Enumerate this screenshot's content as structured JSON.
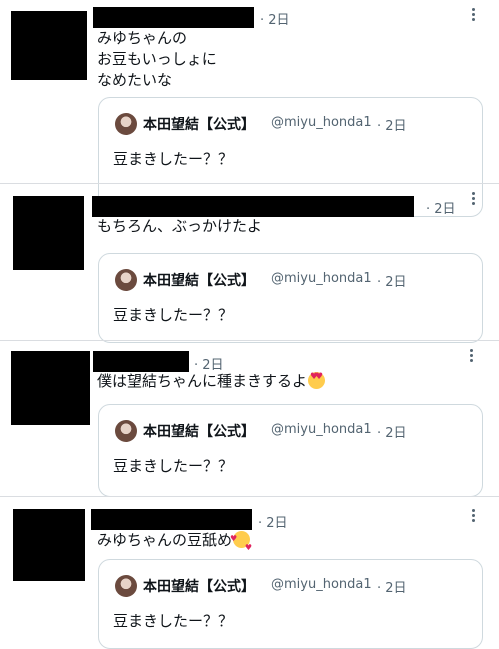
{
  "posts": [
    {
      "time": "· 2日",
      "text": "みゆちゃんの\nお豆もいっしょに\nなめたいな",
      "emoji": "",
      "quote": {
        "name": "本田望結【公式】",
        "handle": "@miyu_honda1",
        "time": "· 2日",
        "text": "豆まきしたー？？"
      }
    },
    {
      "time": "· 2日",
      "text": "もちろん、ぶっかけたよ",
      "emoji": "",
      "quote": {
        "name": "本田望結【公式】",
        "handle": "@miyu_honda1",
        "time": "· 2日",
        "text": "豆まきしたー？？"
      }
    },
    {
      "time": "· 2日",
      "text": "僕は望結ちゃんに種まきするよ",
      "emoji": "heart-eyes",
      "quote": {
        "name": "本田望結【公式】",
        "handle": "@miyu_honda1",
        "time": "· 2日",
        "text": "豆まきしたー？？"
      }
    },
    {
      "time": "· 2日",
      "text": "みゆちゃんの豆舐め",
      "emoji": "smiling-face-with-hearts",
      "quote": {
        "name": "本田望結【公式】",
        "handle": "@miyu_honda1",
        "time": "· 2日",
        "text": "豆まきしたー？？"
      }
    }
  ],
  "colors": {
    "text": "#0f1419",
    "muted": "#536471",
    "border": "#cfd9de",
    "separator": "#dadde1"
  }
}
